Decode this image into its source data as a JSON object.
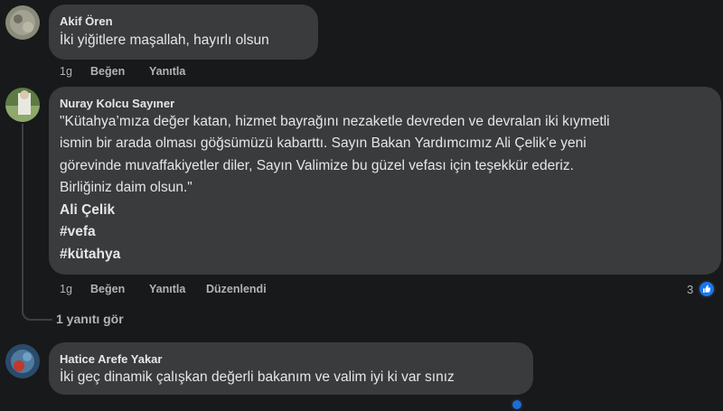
{
  "comments": [
    {
      "author": "Akif Ören",
      "lines": [
        "İki yiğitlere maşallah, hayırlı olsun"
      ],
      "time": "1g",
      "like": "Beğen",
      "reply": "Yanıtla"
    },
    {
      "author": "Nuray Kolcu Sayıner",
      "lines": [
        "\"Kütahya’mıza değer katan, hizmet bayrağını nezaketle devreden ve devralan iki kıymetli",
        "ismin bir arada olması göğsümüzü kabarttı. Sayın Bakan Yardımcımız Ali Çelik’e yeni",
        "görevinde muvaffakiyetler diler, Sayın Valimize bu güzel vefası için teşekkür ederiz.",
        "Birliğiniz daim olsun.\""
      ],
      "tags": [
        "Ali Çelik",
        "#vefa",
        "#kütahya"
      ],
      "time": "1g",
      "like": "Beğen",
      "reply": "Yanıtla",
      "edited": "Düzenlendi",
      "reaction_count": "3",
      "reaction_icon": "like-icon",
      "view_replies": "1 yanıtı gör"
    },
    {
      "author": "Hatice Arefe Yakar",
      "lines": [
        "İki geç dinamik çalışkan değerli bakanım ve valim iyi ki var sınız"
      ]
    }
  ],
  "colors": {
    "background": "#18191a",
    "bubble": "#3a3b3c",
    "text": "#e4e6eb",
    "secondary": "#b0b3b8",
    "like_blue": "#1877f2"
  }
}
